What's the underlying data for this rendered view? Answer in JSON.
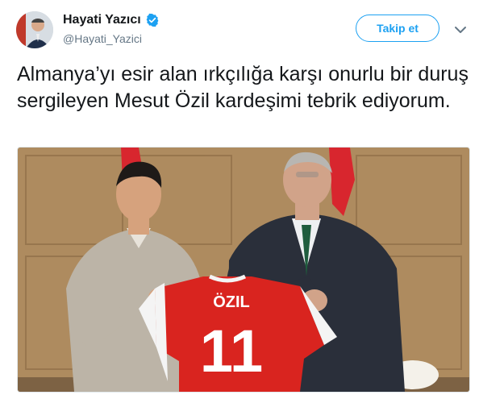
{
  "user": {
    "display_name": "Hayati Yazıcı",
    "handle": "@Hayati_Yazici",
    "verified_icon": "verified-badge-icon"
  },
  "actions": {
    "follow_label": "Takip et",
    "more_icon": "chevron-down-icon"
  },
  "tweet": {
    "text": "Almanya’yı esir alan ırkçılığa karşı onurlu bir duruş sergileyen Mesut Özil kardeşimi tebrik ediyorum."
  },
  "media": {
    "jersey_name": "ÖZIL",
    "jersey_number": "11"
  },
  "colors": {
    "accent": "#1da1f2",
    "text": "#14171a",
    "muted": "#657786"
  }
}
